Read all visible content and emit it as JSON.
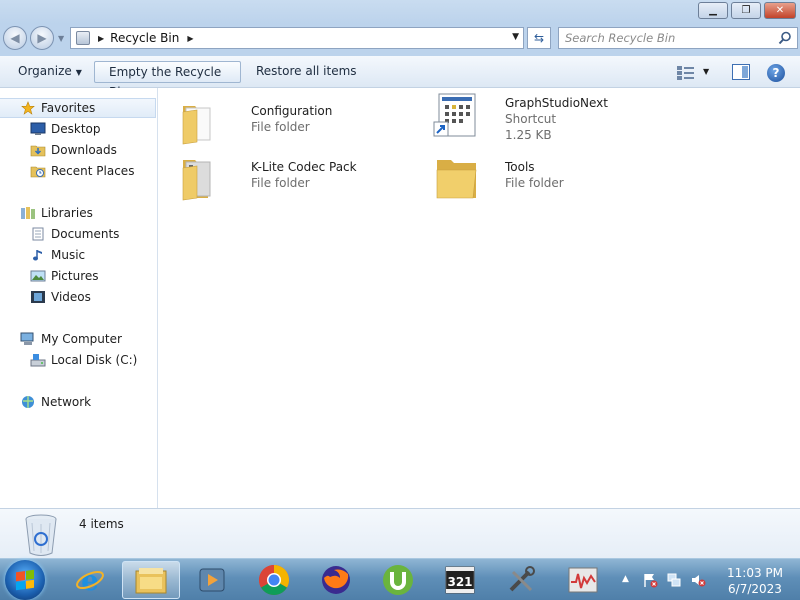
{
  "window": {
    "address": {
      "location": "Recycle Bin"
    },
    "search": {
      "placeholder": "Search Recycle Bin"
    }
  },
  "toolbar": {
    "organize_label": "Organize",
    "empty_label": "Empty the Recycle Bin",
    "restore_label": "Restore all items"
  },
  "navigation": {
    "favorites": {
      "label": "Favorites",
      "items": [
        {
          "label": "Desktop"
        },
        {
          "label": "Downloads"
        },
        {
          "label": "Recent Places"
        }
      ]
    },
    "libraries": {
      "label": "Libraries",
      "items": [
        {
          "label": "Documents"
        },
        {
          "label": "Music"
        },
        {
          "label": "Pictures"
        },
        {
          "label": "Videos"
        }
      ]
    },
    "computer": {
      "label": "My Computer",
      "items": [
        {
          "label": "Local Disk (C:)"
        }
      ]
    },
    "network": {
      "label": "Network"
    }
  },
  "files": [
    {
      "name": "Configuration",
      "type": "File folder",
      "icon": "folder-icon"
    },
    {
      "name": "GraphStudioNext",
      "type": "Shortcut",
      "size": "1.25 KB",
      "icon": "shortcut-icon"
    },
    {
      "name": "K-Lite Codec Pack",
      "type": "File folder",
      "icon": "folder-icon"
    },
    {
      "name": "Tools",
      "type": "File folder",
      "icon": "folder-icon"
    }
  ],
  "details": {
    "count": "4 items"
  },
  "taskbar": {
    "apps": [
      "internet-explorer-icon",
      "windows-explorer-icon",
      "media-player-icon",
      "chrome-icon",
      "firefox-icon",
      "utorrent-icon",
      "mpc-hc-icon",
      "tools-icon",
      "monitor-icon"
    ],
    "clock": {
      "time": "11:03 PM",
      "date": "6/7/2023"
    }
  },
  "colors": {
    "titlebar": "#bcd3ec",
    "toolbar": "#dde8f4",
    "folder": "#e8c35a",
    "taskbar": "#5f8fb8"
  }
}
